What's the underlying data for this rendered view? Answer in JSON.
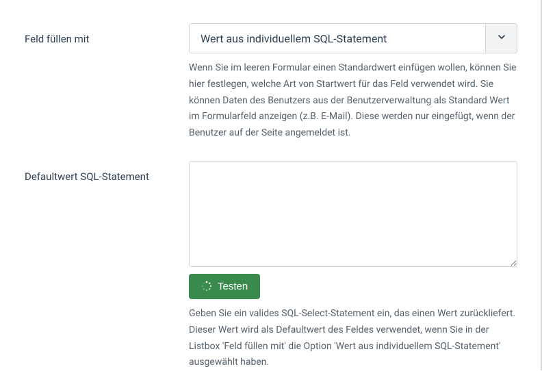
{
  "field_fill": {
    "label": "Feld füllen mit",
    "value": "Wert aus individuellem SQL-Statement",
    "help": "Wenn Sie im leeren Formular einen Standardwert einfügen wollen, können Sie hier festlegen, welche Art von Startwert für das Feld verwendet wird. Sie können Daten des Benutzers aus der Benutzerverwaltung als Standard Wert im Formularfeld anzeigen (z.B. E-Mail). Diese werden nur eingefügt, wenn der Benutzer auf der Seite angemeldet ist."
  },
  "default_sql": {
    "label": "Defaultwert SQL-Statement",
    "value": "",
    "test_button": "Testen",
    "help": "Geben Sie ein valides SQL-Select-Statement ein, das einen Wert zurückliefert. Dieser Wert wird als Defaultwert des Feldes verwendet, wenn Sie in der Listbox 'Feld füllen mit' die Option 'Wert aus individuellem SQL-Statement' ausgewählt haben."
  }
}
